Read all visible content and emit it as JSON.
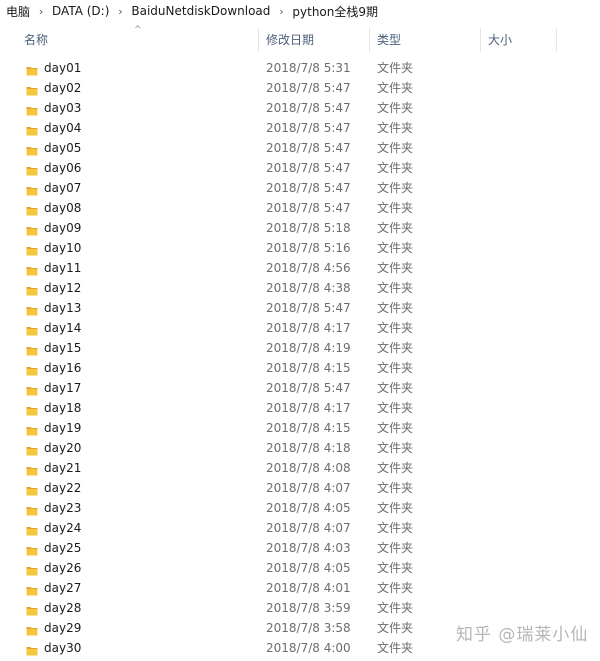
{
  "breadcrumb": [
    "电脑",
    "DATA (D:)",
    "BaiduNetdiskDownload",
    "python全栈9期"
  ],
  "columns": {
    "name": "名称",
    "modified": "修改日期",
    "type": "类型",
    "size": "大小"
  },
  "colors": {
    "folder_yellow": "#f5c542",
    "folder_back": "#e0a722",
    "header_text": "#4c607a"
  },
  "rows": [
    {
      "name": "day01",
      "modified": "2018/7/8 5:31",
      "type": "文件夹"
    },
    {
      "name": "day02",
      "modified": "2018/7/8 5:47",
      "type": "文件夹"
    },
    {
      "name": "day03",
      "modified": "2018/7/8 5:47",
      "type": "文件夹"
    },
    {
      "name": "day04",
      "modified": "2018/7/8 5:47",
      "type": "文件夹"
    },
    {
      "name": "day05",
      "modified": "2018/7/8 5:47",
      "type": "文件夹"
    },
    {
      "name": "day06",
      "modified": "2018/7/8 5:47",
      "type": "文件夹"
    },
    {
      "name": "day07",
      "modified": "2018/7/8 5:47",
      "type": "文件夹"
    },
    {
      "name": "day08",
      "modified": "2018/7/8 5:47",
      "type": "文件夹"
    },
    {
      "name": "day09",
      "modified": "2018/7/8 5:18",
      "type": "文件夹"
    },
    {
      "name": "day10",
      "modified": "2018/7/8 5:16",
      "type": "文件夹"
    },
    {
      "name": "day11",
      "modified": "2018/7/8 4:56",
      "type": "文件夹"
    },
    {
      "name": "day12",
      "modified": "2018/7/8 4:38",
      "type": "文件夹"
    },
    {
      "name": "day13",
      "modified": "2018/7/8 5:47",
      "type": "文件夹"
    },
    {
      "name": "day14",
      "modified": "2018/7/8 4:17",
      "type": "文件夹"
    },
    {
      "name": "day15",
      "modified": "2018/7/8 4:19",
      "type": "文件夹"
    },
    {
      "name": "day16",
      "modified": "2018/7/8 4:15",
      "type": "文件夹"
    },
    {
      "name": "day17",
      "modified": "2018/7/8 5:47",
      "type": "文件夹"
    },
    {
      "name": "day18",
      "modified": "2018/7/8 4:17",
      "type": "文件夹"
    },
    {
      "name": "day19",
      "modified": "2018/7/8 4:15",
      "type": "文件夹"
    },
    {
      "name": "day20",
      "modified": "2018/7/8 4:18",
      "type": "文件夹"
    },
    {
      "name": "day21",
      "modified": "2018/7/8 4:08",
      "type": "文件夹"
    },
    {
      "name": "day22",
      "modified": "2018/7/8 4:07",
      "type": "文件夹"
    },
    {
      "name": "day23",
      "modified": "2018/7/8 4:05",
      "type": "文件夹"
    },
    {
      "name": "day24",
      "modified": "2018/7/8 4:07",
      "type": "文件夹"
    },
    {
      "name": "day25",
      "modified": "2018/7/8 4:03",
      "type": "文件夹"
    },
    {
      "name": "day26",
      "modified": "2018/7/8 4:05",
      "type": "文件夹"
    },
    {
      "name": "day27",
      "modified": "2018/7/8 4:01",
      "type": "文件夹"
    },
    {
      "name": "day28",
      "modified": "2018/7/8 3:59",
      "type": "文件夹"
    },
    {
      "name": "day29",
      "modified": "2018/7/8 3:58",
      "type": "文件夹"
    },
    {
      "name": "day30",
      "modified": "2018/7/8 4:00",
      "type": "文件夹"
    }
  ],
  "watermark": "知乎 @瑞莱小仙"
}
